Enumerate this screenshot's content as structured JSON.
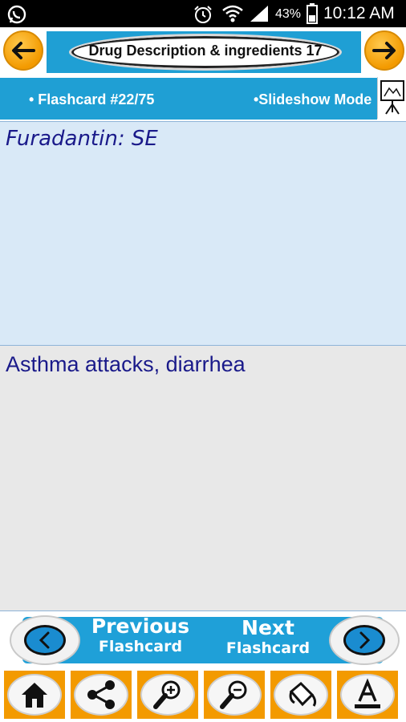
{
  "status_bar": {
    "battery": "43%",
    "time": "10:12 AM",
    "icons": [
      "whatsapp-icon",
      "alarm-icon",
      "wifi-icon",
      "signal-icon",
      "battery-icon"
    ]
  },
  "header": {
    "title": "Drug Description & ingredients 17",
    "back_icon": "arrow-left-icon",
    "forward_icon": "arrow-right-icon"
  },
  "info": {
    "flashcard_label": "• Flashcard #22/75",
    "slideshow_label": "•Slideshow Mode",
    "slideshow_icon": "slideshow-easel-icon"
  },
  "card": {
    "question": "Furadantin: SE",
    "answer": "Asthma attacks, diarrhea"
  },
  "nav": {
    "previous_line1": "Previous",
    "previous_line2": "Flashcard",
    "next_line1": "Next",
    "next_line2": "Flashcard"
  },
  "toolbar": {
    "tools": [
      "home-icon",
      "share-icon",
      "zoom-in-icon",
      "zoom-out-icon",
      "paint-bucket-icon",
      "text-color-icon"
    ]
  },
  "colors": {
    "accent_blue": "#1f9fd4",
    "accent_orange": "#f39a00",
    "question_bg": "#d9e9f7",
    "answer_bg": "#e8e8e8",
    "text_navy": "#1a1a8a"
  }
}
